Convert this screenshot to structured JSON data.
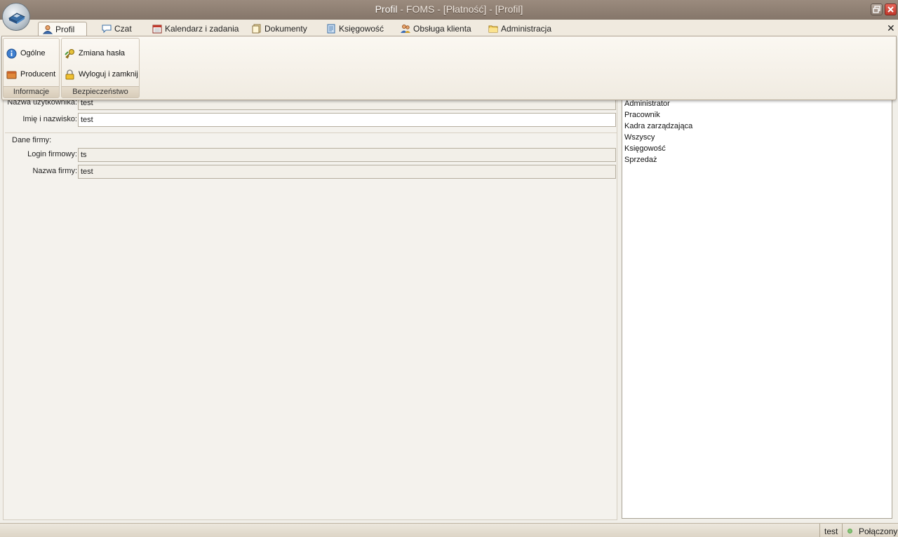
{
  "window": {
    "title_main": "Profil",
    "title_rest": " - FOMS - [Płatność] - [Profil]"
  },
  "tabs": [
    {
      "label": "Profil",
      "icon": "user-icon",
      "active": true
    },
    {
      "label": "Czat",
      "icon": "chat-bubble-icon",
      "active": false
    },
    {
      "label": "Kalendarz i zadania",
      "icon": "calendar-icon",
      "active": false
    },
    {
      "label": "Dokumenty",
      "icon": "documents-icon",
      "active": false
    },
    {
      "label": "Księgowość",
      "icon": "ledger-icon",
      "active": false
    },
    {
      "label": "Obsługa klienta",
      "icon": "customer-service-icon",
      "active": false
    },
    {
      "label": "Administracja",
      "icon": "folder-icon",
      "active": false
    }
  ],
  "ribbon": {
    "groups": [
      {
        "caption": "Informacje",
        "buttons": [
          {
            "label": "Ogólne",
            "icon": "info-icon"
          },
          {
            "label": "Producent",
            "icon": "box-icon"
          }
        ]
      },
      {
        "caption": "Bezpieczeństwo",
        "buttons": [
          {
            "label": "Zmiana hasła",
            "icon": "key-icon"
          },
          {
            "label": "Wyloguj i zamknij",
            "icon": "lock-icon"
          }
        ]
      }
    ]
  },
  "form": {
    "user_label": "Nazwa użytkownika:",
    "user_value": "test",
    "fullname_label": "Imię i nazwisko:",
    "fullname_value": "test",
    "company_section": "Dane firmy:",
    "login_label": "Login firmowy:",
    "login_value": "ts",
    "company_label": "Nazwa firmy:",
    "company_value": "test"
  },
  "roles": [
    "Administrator",
    "Pracownik",
    "Kadra zarządzająca",
    "Wszyscy",
    "Księgowość",
    "Sprzedaż"
  ],
  "status": {
    "user": "test",
    "connection": "Połączony"
  }
}
